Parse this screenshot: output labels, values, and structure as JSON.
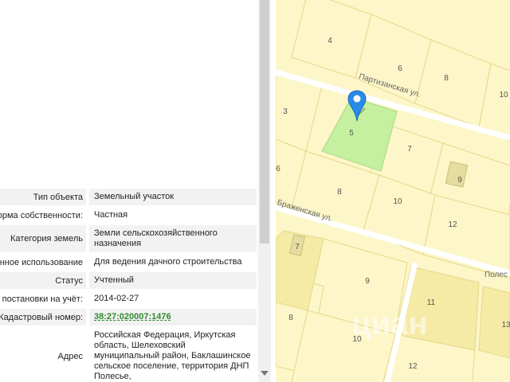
{
  "properties": [
    {
      "label": "Тип объекта",
      "value": "Земельный участок"
    },
    {
      "label": "Форма собственности:",
      "value": "Частная"
    },
    {
      "label": "Категория земель",
      "value": "Земли сельскохозяйственного назначения"
    },
    {
      "label": "Разрешенное использование",
      "value": "Для ведения дачного строительства"
    },
    {
      "label": "Статус",
      "value": "Учтенный"
    },
    {
      "label": "Дата постановки на учёт:",
      "value": "2014-02-27"
    },
    {
      "label": "Кадастровый номер:",
      "value": "38:27:020007:1476"
    },
    {
      "label": "Адрес",
      "value": "Российская Федерация, Иркутская область, Шелеховский муниципальный район, Баклашинское сельское поселение, территория ДНП Полесье,"
    }
  ],
  "map": {
    "streets": {
      "partizanskaya": "Партизанская ул.",
      "brazhenskaya": "Браженская ул.",
      "polesye": "Полес"
    },
    "plots": [
      "4",
      "6",
      "8",
      "10",
      "3",
      "5",
      "7",
      "9",
      "6",
      "8",
      "10",
      "12",
      "7",
      "9",
      "11",
      "8",
      "10",
      "12",
      "13"
    ],
    "watermark": "циан",
    "selected_color": "#c5f0a0",
    "plot_color": "#fdf6c8",
    "built_color": "#f5eaa6"
  }
}
